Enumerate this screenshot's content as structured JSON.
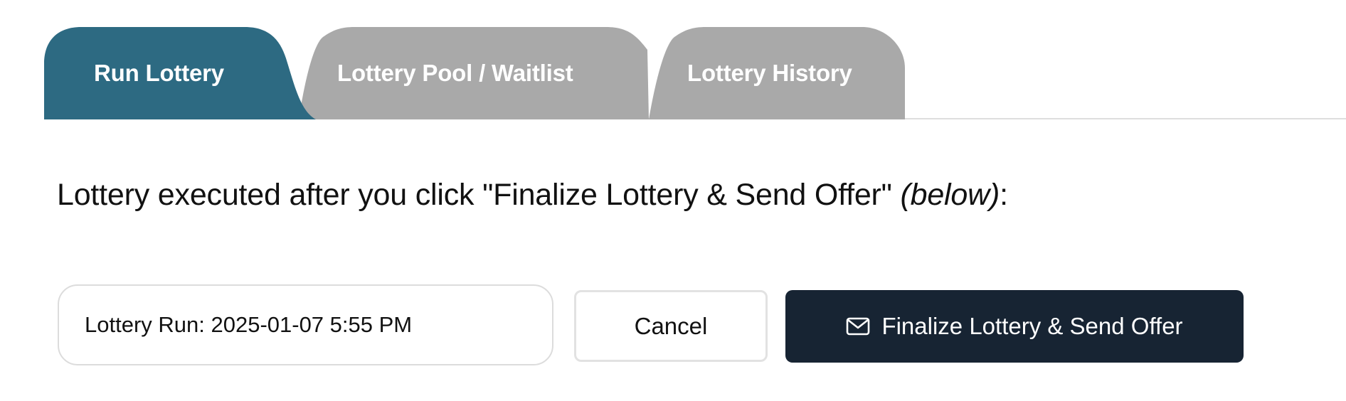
{
  "tabs": [
    {
      "label": "Run Lottery",
      "active": true
    },
    {
      "label": "Lottery Pool / Waitlist",
      "active": false
    },
    {
      "label": "Lottery History",
      "active": false
    }
  ],
  "instruction": {
    "text": "Lottery executed after you click \"Finalize Lottery & Send Offer\" ",
    "emphasis": "(below)",
    "suffix": ":"
  },
  "lottery_run_field": {
    "value": "Lottery Run: 2025-01-07 5:55 PM"
  },
  "actions": {
    "cancel_label": "Cancel",
    "finalize_label": "Finalize Lottery & Send Offer",
    "finalize_icon": "mail-icon"
  },
  "colors": {
    "active_tab": "#2d6a82",
    "inactive_tab": "#a9a9a9",
    "primary_button": "#172433",
    "tab_baseline": "#dedede"
  }
}
